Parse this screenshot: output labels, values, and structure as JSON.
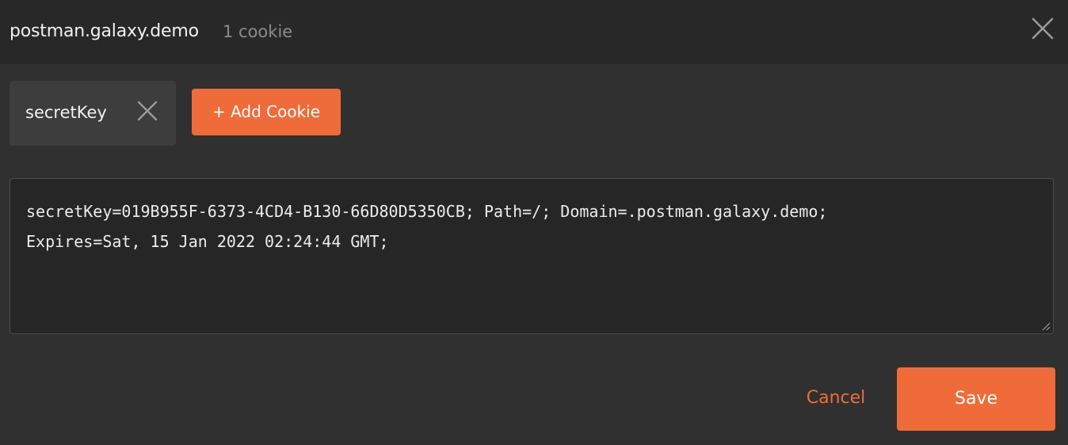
{
  "header": {
    "domain": "postman.galaxy.demo",
    "count": "1 cookie",
    "close_icon": "close-icon"
  },
  "cookie_tabs": [
    {
      "label": "secretKey",
      "remove_icon": "close-icon"
    }
  ],
  "toolbar": {
    "add_cookie_label": "+ Add Cookie"
  },
  "editor": {
    "value": "secretKey=019B955F-6373-4CD4-B130-66D80D5350CB; Path=/; Domain=.postman.galaxy.demo;\nExpires=Sat, 15 Jan 2022 02:24:44 GMT;"
  },
  "footer": {
    "cancel_label": "Cancel",
    "save_label": "Save"
  },
  "colors": {
    "accent": "#ef6c3a",
    "background": "#303030",
    "header_background": "#282828",
    "editor_background": "#262626",
    "text": "#f0f0f0",
    "muted_text": "#8c8c8c"
  }
}
